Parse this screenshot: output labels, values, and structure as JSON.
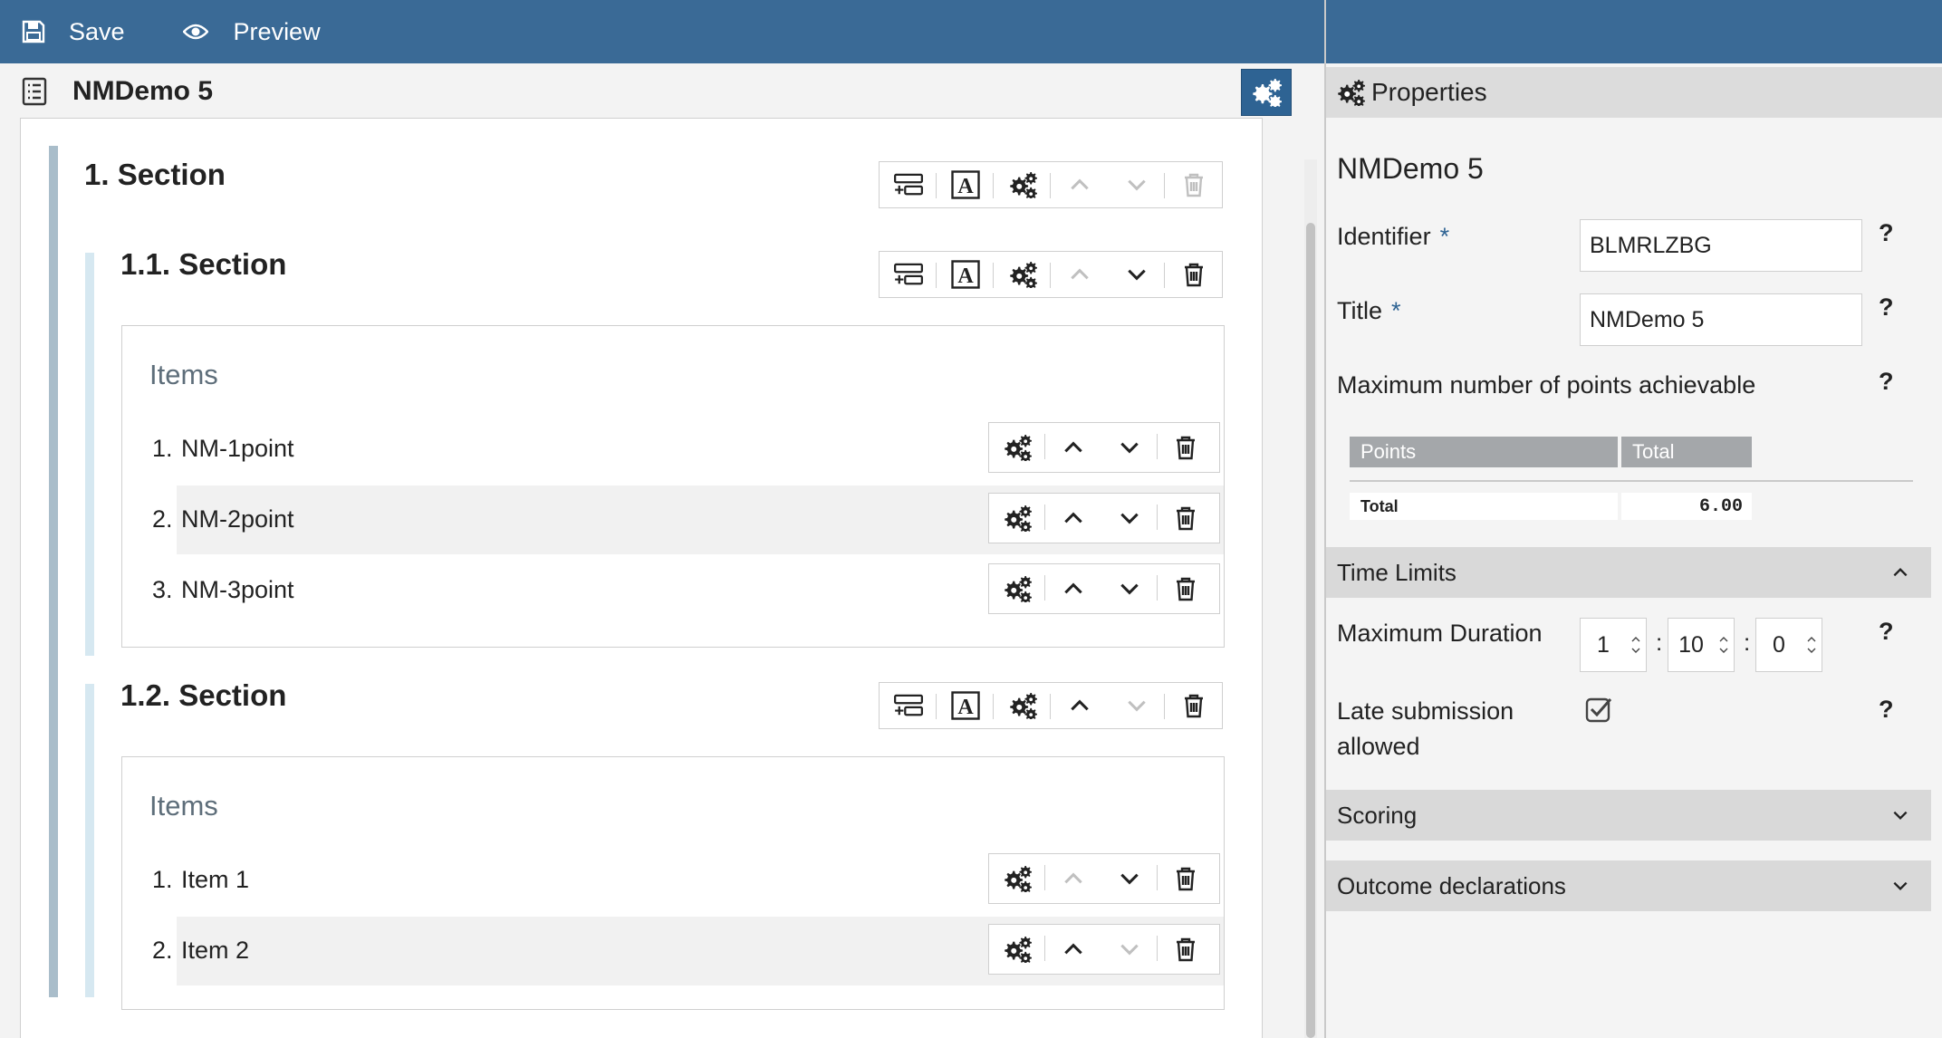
{
  "toolbar": {
    "save_label": "Save",
    "preview_label": "Preview"
  },
  "test": {
    "title": "NMDemo 5"
  },
  "sections": [
    {
      "title": "1. Section"
    },
    {
      "title": "1.1. Section",
      "items_title": "Items",
      "items": [
        {
          "num": "1.",
          "name": "NM-1point"
        },
        {
          "num": "2.",
          "name": "NM-2point"
        },
        {
          "num": "3.",
          "name": "NM-3point"
        }
      ]
    },
    {
      "title": "1.2. Section",
      "items_title": "Items",
      "items": [
        {
          "num": "1.",
          "name": "Item 1"
        },
        {
          "num": "2.",
          "name": "Item 2"
        }
      ]
    }
  ],
  "properties": {
    "header": "Properties",
    "name": "NMDemo 5",
    "identifier_label": "Identifier",
    "identifier_value": "BLMRLZBG",
    "title_label": "Title",
    "title_value": "NMDemo 5",
    "required_mark": "*",
    "help_mark": "?",
    "max_points_label": "Maximum number of points achievable",
    "points_table": {
      "headers": [
        "Points",
        "Total"
      ],
      "rows": [
        {
          "label": "Total",
          "value": "6.00"
        }
      ]
    },
    "time_limits": {
      "heading": "Time Limits",
      "max_duration_label": "Maximum Duration",
      "hours": "1",
      "minutes": "10",
      "seconds": "0",
      "separator": ":",
      "late_submission_label_1": "Late submission",
      "late_submission_label_2": "allowed",
      "late_submission_checked": true
    },
    "scoring_heading": "Scoring",
    "outcome_heading": "Outcome declarations"
  },
  "colors": {
    "toolbar": "#3a6a96",
    "accent": "#2e6393",
    "section_bar_outer": "#a9bdca",
    "section_bar_inner": "#d6e8f1"
  }
}
